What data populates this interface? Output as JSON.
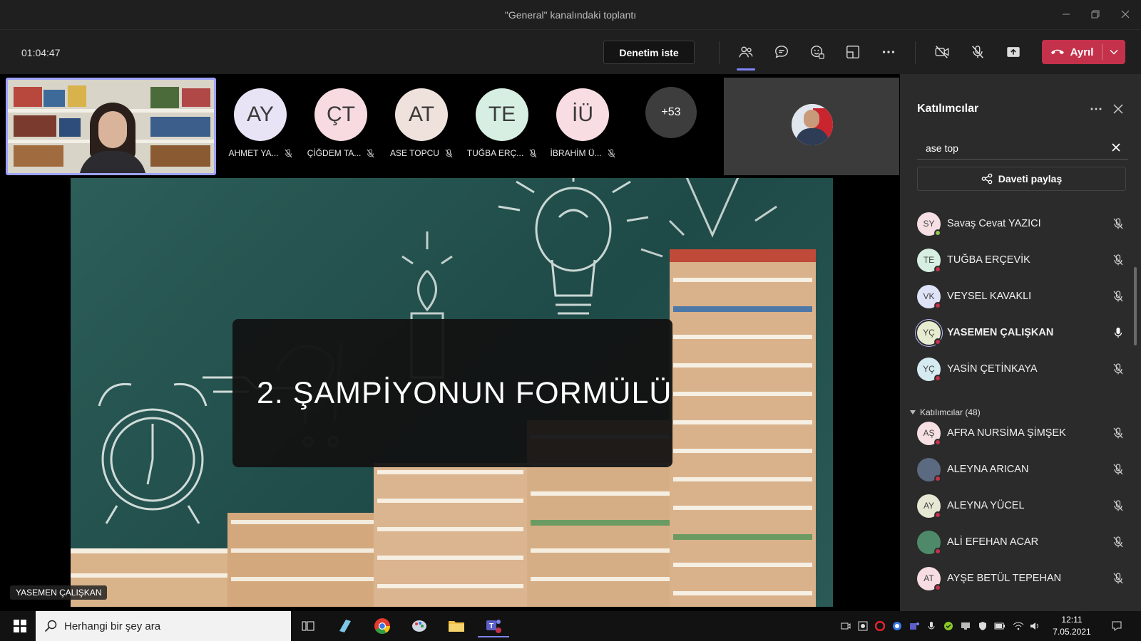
{
  "window": {
    "title": "\"General\" kanalındaki toplantı"
  },
  "toolbar": {
    "timer": "01:04:47",
    "control_label": "Denetim iste",
    "leave_label": "Ayrıl"
  },
  "stage": {
    "participants": [
      {
        "initials": "AY",
        "name": "AHMET YA...",
        "color": "#e8e4f6"
      },
      {
        "initials": "ÇT",
        "name": "ÇİĞDEM TA...",
        "color": "#f7dbe0"
      },
      {
        "initials": "AT",
        "name": "ASE TOPCU",
        "color": "#efe2dc"
      },
      {
        "initials": "TE",
        "name": "TUĞBA ERÇ...",
        "color": "#d6efe2"
      },
      {
        "initials": "İÜ",
        "name": "İBRAHİM Ü...",
        "color": "#f8dde2"
      }
    ],
    "more_count": "+53",
    "slide_title": "2. ŞAMPİYONUN FORMÜLÜ",
    "speaker": "YASEMEN ÇALIŞKAN"
  },
  "panel": {
    "title": "Katılımcılar",
    "search_value": "ase top",
    "invite_label": "Daveti paylaş",
    "section_label": "Katılımcılar (48)",
    "top_people": [
      {
        "initials": "SY",
        "name": "Savaş Cevat YAZICI",
        "color": "#f6dfe4",
        "status": "#92c353",
        "mic": "muted"
      },
      {
        "initials": "TE",
        "name": "TUĞBA ERÇEVİK",
        "color": "#d6efe2",
        "status": "#c4314b",
        "mic": "muted"
      },
      {
        "initials": "VK",
        "name": "VEYSEL KAVAKLI",
        "color": "#dfe3f7",
        "status": "#c4314b",
        "mic": "muted"
      },
      {
        "initials": "YÇ",
        "name": "YASEMEN ÇALIŞKAN",
        "color": "#e7ecd0",
        "status": "#c4314b",
        "mic": "on"
      },
      {
        "initials": "YÇ",
        "name": "YASİN ÇETİNKAYA",
        "color": "#d5eaf1",
        "status": "#c4314b",
        "mic": "muted"
      }
    ],
    "people": [
      {
        "initials": "AŞ",
        "name": "AFRA NURSİMA ŞİMŞEK",
        "color": "#f7e0e4",
        "status": "#c4314b",
        "mic": "muted"
      },
      {
        "initials": "",
        "name": "ALEYNA ARICAN",
        "color": "#5b6a80",
        "status": "#c4314b",
        "mic": "muted"
      },
      {
        "initials": "AY",
        "name": "ALEYNA YÜCEL",
        "color": "#e6e8d4",
        "status": "#c4314b",
        "mic": "muted"
      },
      {
        "initials": "",
        "name": "ALİ EFEHAN ACAR",
        "color": "#4e8a6a",
        "status": "#c4314b",
        "mic": "muted"
      },
      {
        "initials": "AT",
        "name": "AYŞE BETÜL TEPEHAN",
        "color": "#f7dde3",
        "status": "#c4314b",
        "mic": "muted"
      }
    ]
  },
  "taskbar": {
    "search_placeholder": "Herhangi bir şey ara",
    "time": "12:11",
    "date": "7.05.2021"
  },
  "colors": {
    "accent": "#7f85f5",
    "leave": "#c4314b",
    "panel": "#2b2b2b"
  }
}
